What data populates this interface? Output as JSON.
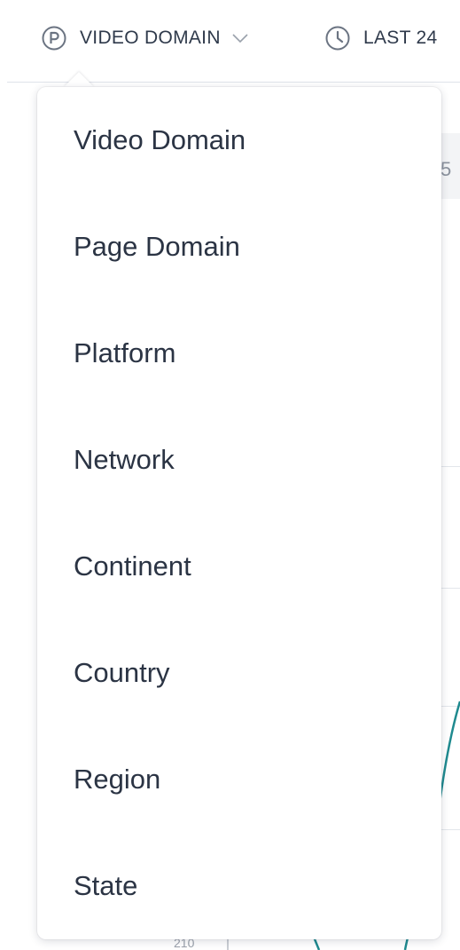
{
  "toolbar": {
    "items": [
      {
        "label": "VIDEO DOMAIN",
        "icon": "property-p-icon",
        "has_dropdown": true
      },
      {
        "label": "LAST 24",
        "icon": "clock-icon",
        "has_dropdown": false
      }
    ]
  },
  "background": {
    "partial_text": "5",
    "axis_label": "210"
  },
  "dropdown": {
    "items": [
      {
        "label": "Video Domain"
      },
      {
        "label": "Page Domain"
      },
      {
        "label": "Platform"
      },
      {
        "label": "Network"
      },
      {
        "label": "Continent"
      },
      {
        "label": "Country"
      },
      {
        "label": "Region"
      },
      {
        "label": "State"
      }
    ]
  },
  "colors": {
    "text": "#2b3444",
    "toolbar_icon": "#6b7482",
    "chart_line": "#1f8a8f",
    "divider": "#dfe3ea"
  }
}
